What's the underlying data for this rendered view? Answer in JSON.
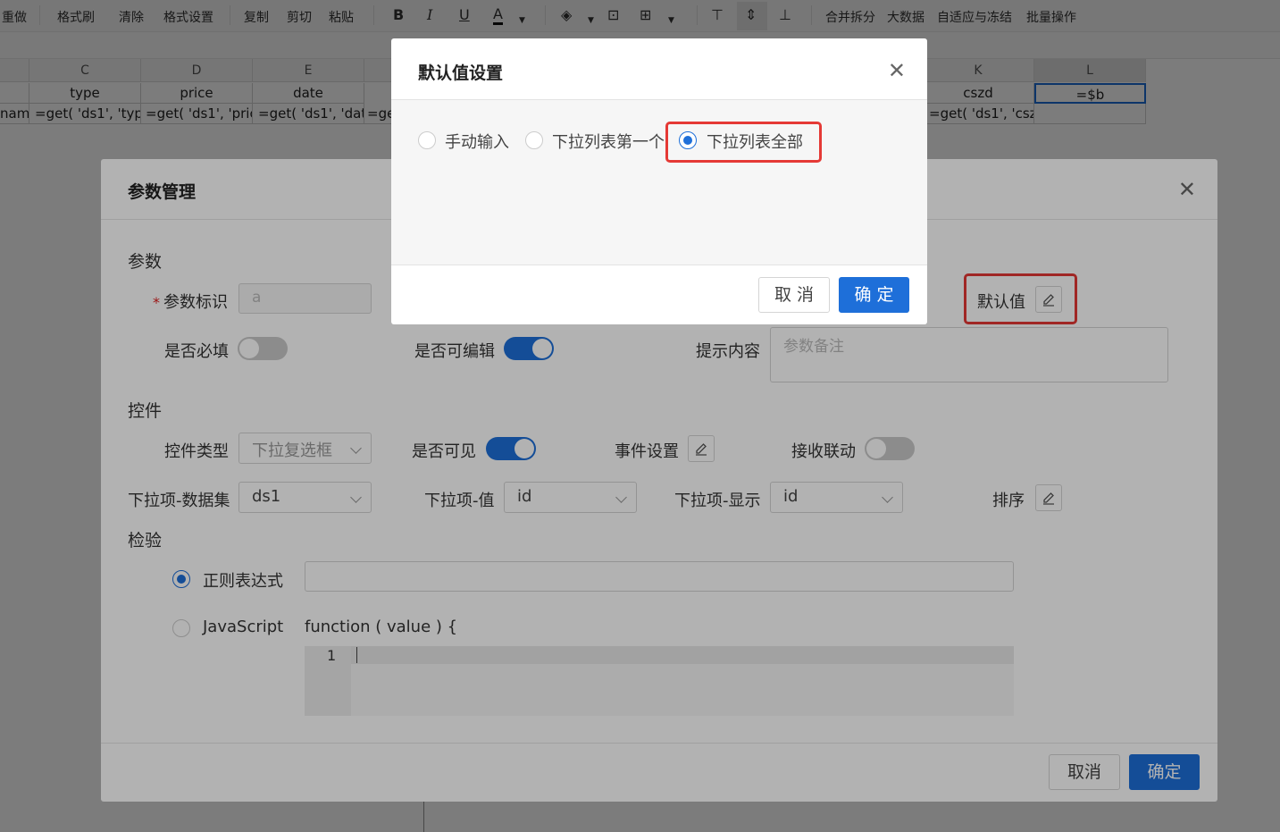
{
  "toolbar": {
    "items": [
      "重做",
      "格式刷",
      "清除",
      "格式设置",
      "复制",
      "剪切",
      "粘贴",
      "合并拆分",
      "大数据",
      "自适应与冻结",
      "批量操作"
    ],
    "icons": [
      "B",
      "I",
      "U",
      "A"
    ]
  },
  "sheet": {
    "columns": [
      "C",
      "D",
      "E",
      "K",
      "L"
    ],
    "row1": [
      "type",
      "price",
      "date",
      "cszd",
      "=$b"
    ],
    "row2": [
      "nam",
      "=get( 'ds1', 'typ",
      "=get( 'ds1', 'pric",
      "=get( 'ds1', 'dat",
      "=ge",
      "=get( 'ds1', 'csz"
    ]
  },
  "param_dialog": {
    "title": "参数管理",
    "section_param": "参数",
    "param_id_label": "参数标识",
    "param_id_value": "a",
    "default_value_label": "默认值",
    "required_label": "是否必填",
    "required_on": false,
    "editable_label": "是否可编辑",
    "editable_on": true,
    "hint_label": "提示内容",
    "hint_placeholder": "参数备注",
    "section_control": "控件",
    "control_type_label": "控件类型",
    "control_type_value": "下拉复选框",
    "visible_label": "是否可见",
    "visible_on": true,
    "event_label": "事件设置",
    "linkage_label": "接收联动",
    "linkage_on": false,
    "dataset_label": "下拉项-数据集",
    "dataset_value": "ds1",
    "value_label": "下拉项-值",
    "value_value": "id",
    "display_label": "下拉项-显示",
    "display_value": "id",
    "sort_label": "排序",
    "section_validate": "检验",
    "regex_label": "正则表达式",
    "regex_selected": true,
    "js_label": "JavaScript",
    "js_signature": "function ( value ) {",
    "line_number": "1",
    "cancel": "取消",
    "confirm": "确定"
  },
  "default_dialog": {
    "title": "默认值设置",
    "options": [
      "手动输入",
      "下拉列表第一个",
      "下拉列表全部"
    ],
    "selected_index": 2,
    "cancel": "取 消",
    "confirm": "确 定"
  },
  "colors": {
    "primary": "#1e6fd9",
    "highlight": "#e53935"
  }
}
